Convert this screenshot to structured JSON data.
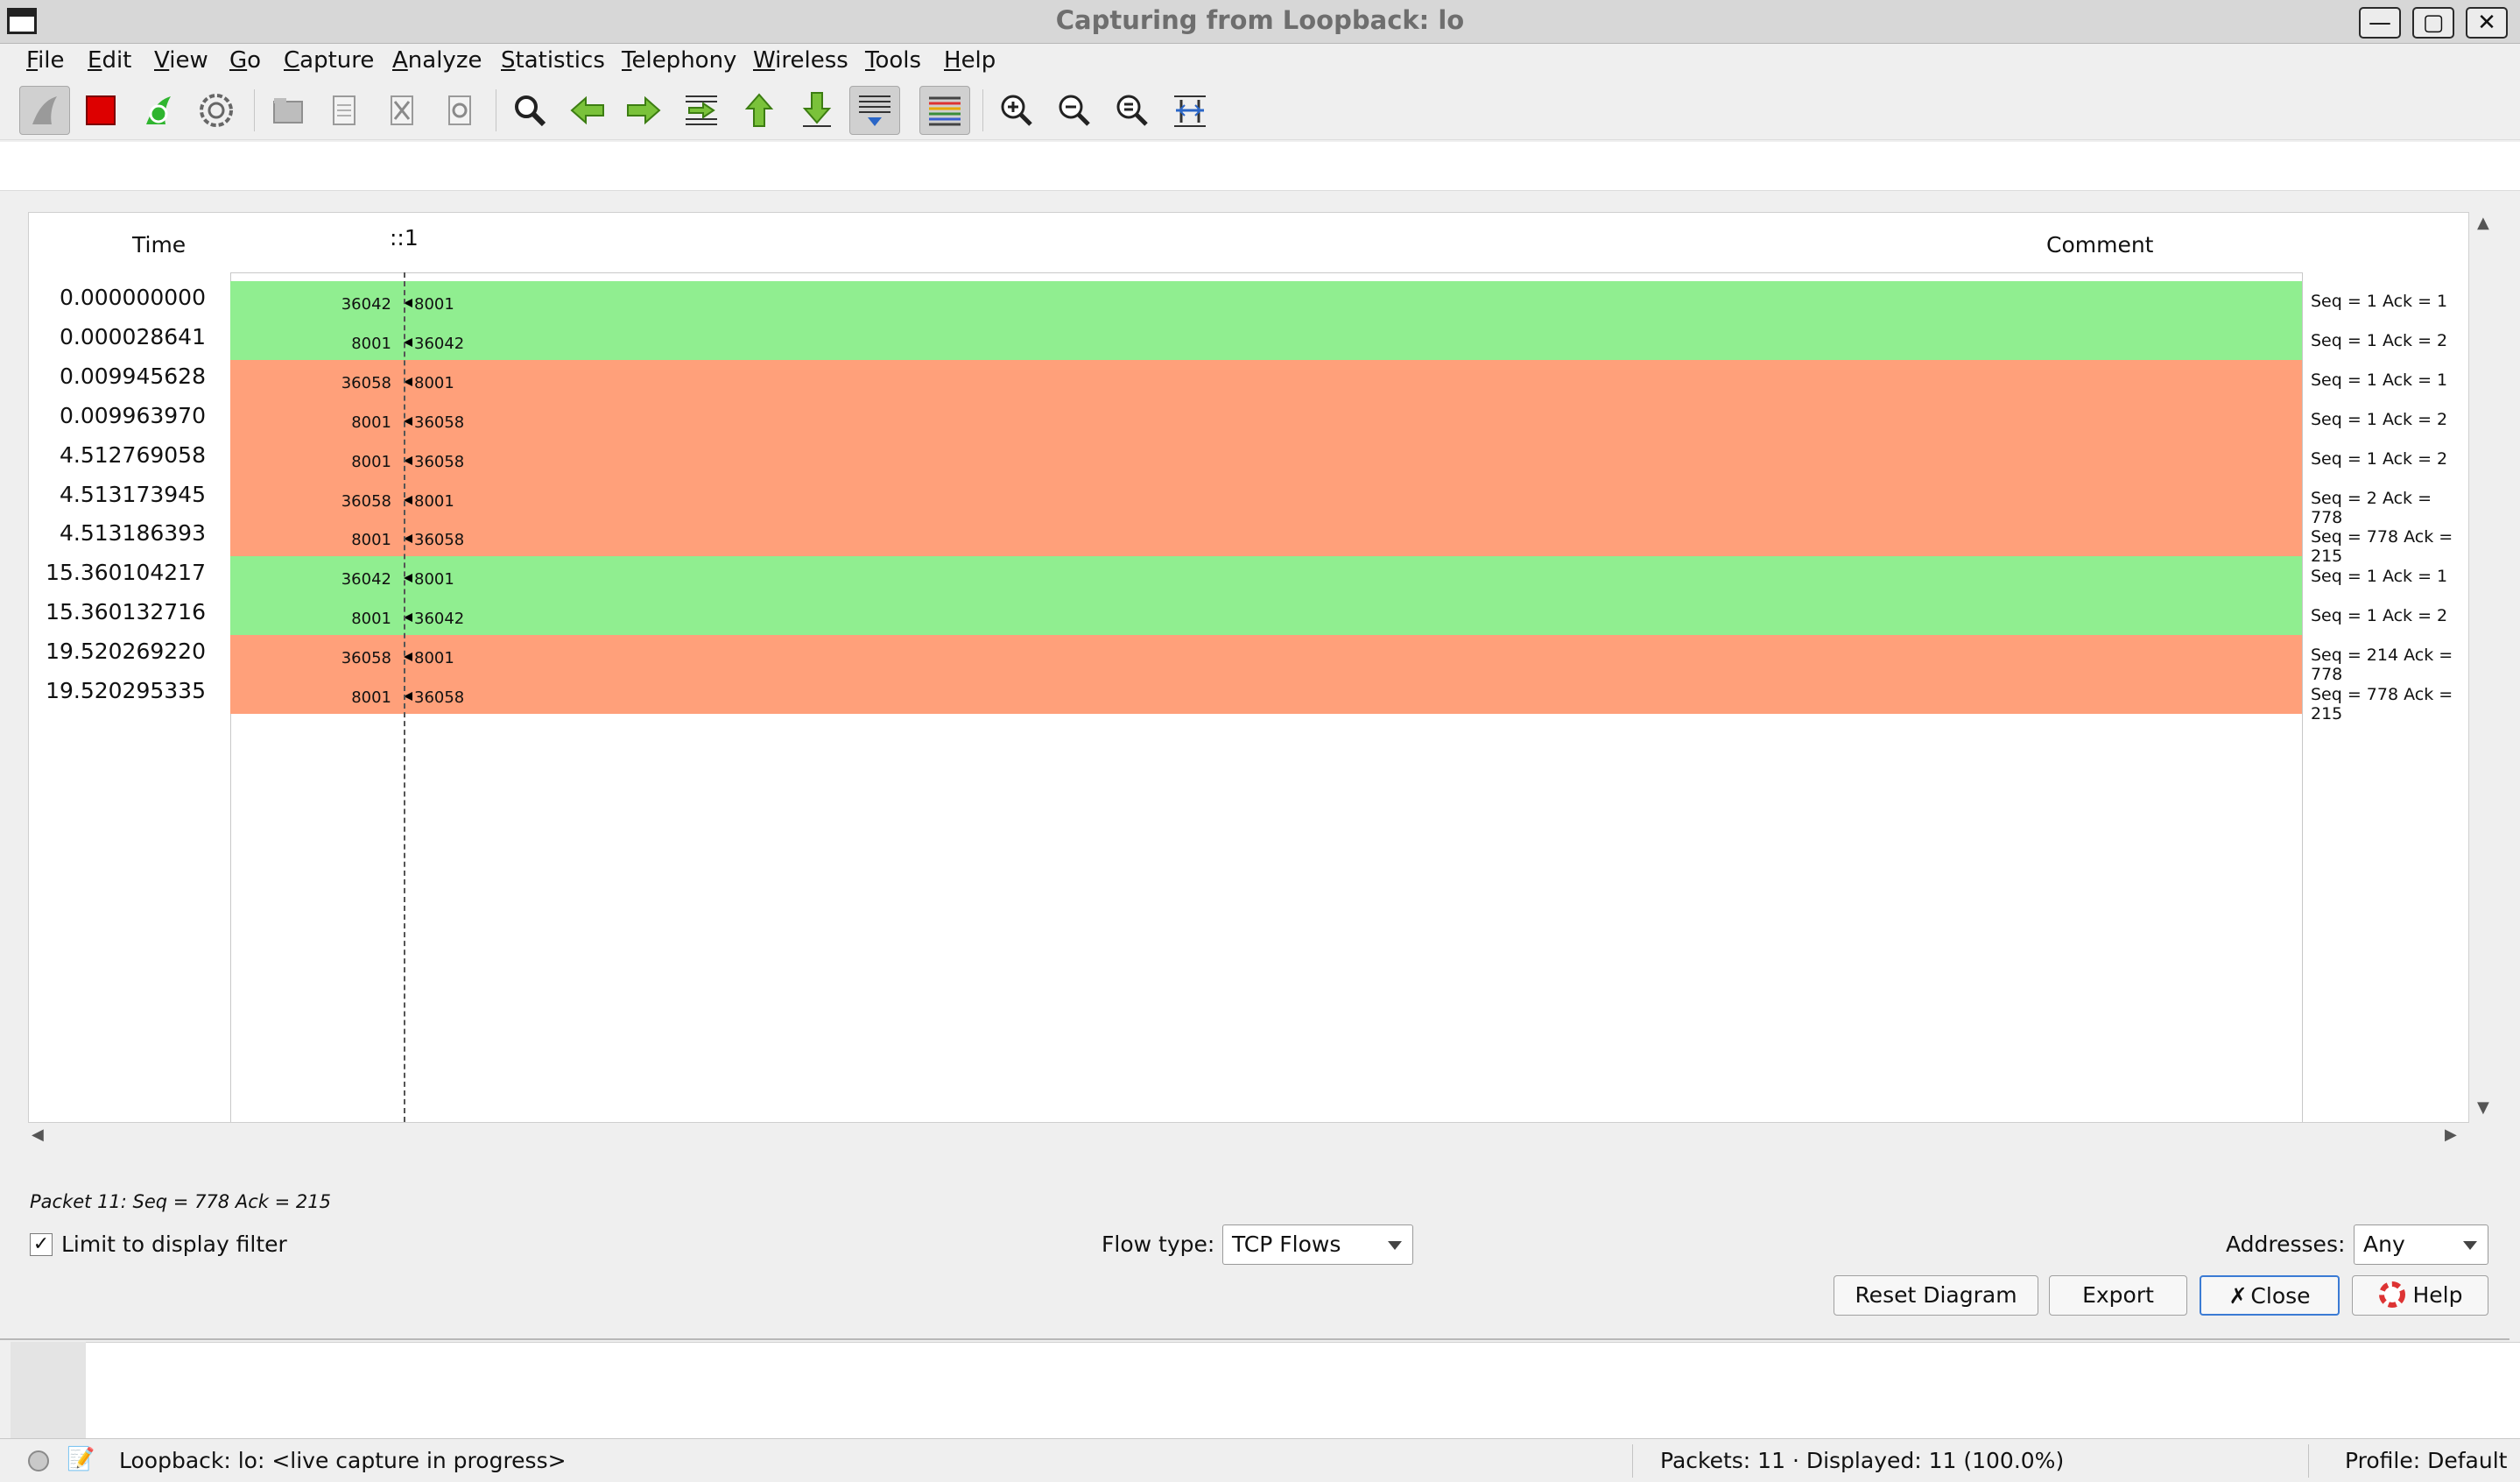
{
  "window": {
    "title": "Capturing from Loopback: lo",
    "controls": {
      "minimize": "—",
      "maximize": "▢",
      "close": "✕"
    }
  },
  "menubar": {
    "items": [
      "File",
      "Edit",
      "View",
      "Go",
      "Capture",
      "Analyze",
      "Statistics",
      "Telephony",
      "Wireless",
      "Tools",
      "Help"
    ]
  },
  "toolbar": {
    "icons": [
      "shark-fin-start-icon",
      "stop-capture-icon",
      "restart-capture-icon",
      "capture-options-icon",
      "open-file-icon",
      "save-file-icon",
      "close-file-icon",
      "reload-file-icon",
      "find-packet-icon",
      "go-back-icon",
      "go-forward-icon",
      "go-to-packet-icon",
      "go-first-icon",
      "go-last-icon",
      "autoscroll-icon",
      "colorize-icon",
      "zoom-in-icon",
      "zoom-out-icon",
      "zoom-normal-icon",
      "resize-columns-icon"
    ]
  },
  "flow": {
    "header": {
      "time": "Time",
      "host": "::1",
      "comment": "Comment"
    },
    "rows": [
      {
        "time": "0.000000000",
        "left_port": "36042",
        "right_port": "8001",
        "comment": "Seq = 1 Ack = 1",
        "color": "green"
      },
      {
        "time": "0.000028641",
        "left_port": "8001",
        "right_port": "36042",
        "comment": "Seq = 1 Ack = 2",
        "color": "green"
      },
      {
        "time": "0.009945628",
        "left_port": "36058",
        "right_port": "8001",
        "comment": "Seq = 1 Ack = 1",
        "color": "orange"
      },
      {
        "time": "0.009963970",
        "left_port": "8001",
        "right_port": "36058",
        "comment": "Seq = 1 Ack = 2",
        "color": "orange"
      },
      {
        "time": "4.512769058",
        "left_port": "8001",
        "right_port": "36058",
        "comment": "Seq = 1 Ack = 2",
        "color": "orange"
      },
      {
        "time": "4.513173945",
        "left_port": "36058",
        "right_port": "8001",
        "comment": "Seq = 2 Ack = 778",
        "color": "orange"
      },
      {
        "time": "4.513186393",
        "left_port": "8001",
        "right_port": "36058",
        "comment": "Seq = 778 Ack = 215",
        "color": "orange"
      },
      {
        "time": "15.360104217",
        "left_port": "36042",
        "right_port": "8001",
        "comment": "Seq = 1 Ack = 1",
        "color": "green"
      },
      {
        "time": "15.360132716",
        "left_port": "8001",
        "right_port": "36042",
        "comment": "Seq = 1 Ack = 2",
        "color": "green"
      },
      {
        "time": "19.520269220",
        "left_port": "36058",
        "right_port": "8001",
        "comment": "Seq = 214 Ack = 778",
        "color": "orange"
      },
      {
        "time": "19.520295335",
        "left_port": "8001",
        "right_port": "36058",
        "comment": "Seq = 778 Ack = 215",
        "color": "orange"
      }
    ],
    "colors": {
      "green": "#90ee90",
      "orange": "#ffa07a"
    }
  },
  "footer": {
    "packet_info": "Packet 11: Seq = 778 Ack = 215",
    "limit_checkbox": {
      "label": "Limit to display filter",
      "checked": true,
      "mark": "✓"
    },
    "flow_type": {
      "label": "Flow type:",
      "value": "TCP Flows"
    },
    "addresses": {
      "label": "Addresses:",
      "value": "Any"
    },
    "buttons": {
      "reset": "Reset Diagram",
      "export": "Export",
      "close": "Close",
      "close_icon": "✗",
      "help": "Help"
    }
  },
  "statusbar": {
    "capture": "Loopback: lo: <live capture in progress>",
    "packets": "Packets: 11 · Displayed: 11 (100.0%)",
    "profile": "Profile: Default"
  }
}
